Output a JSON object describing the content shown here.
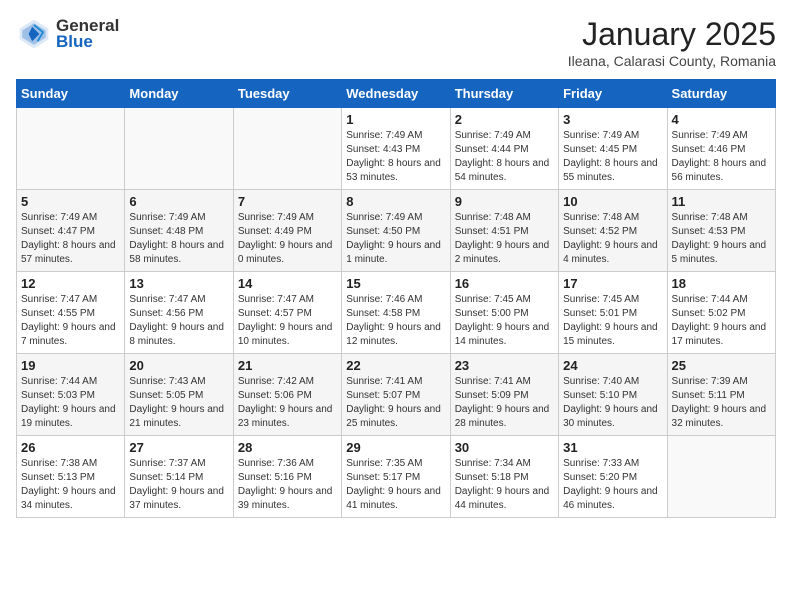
{
  "header": {
    "logo_general": "General",
    "logo_blue": "Blue",
    "title": "January 2025",
    "subtitle": "Ileana, Calarasi County, Romania"
  },
  "weekdays": [
    "Sunday",
    "Monday",
    "Tuesday",
    "Wednesday",
    "Thursday",
    "Friday",
    "Saturday"
  ],
  "weeks": [
    [
      {
        "day": "",
        "sunrise": "",
        "sunset": "",
        "daylight": ""
      },
      {
        "day": "",
        "sunrise": "",
        "sunset": "",
        "daylight": ""
      },
      {
        "day": "",
        "sunrise": "",
        "sunset": "",
        "daylight": ""
      },
      {
        "day": "1",
        "sunrise": "Sunrise: 7:49 AM",
        "sunset": "Sunset: 4:43 PM",
        "daylight": "Daylight: 8 hours and 53 minutes."
      },
      {
        "day": "2",
        "sunrise": "Sunrise: 7:49 AM",
        "sunset": "Sunset: 4:44 PM",
        "daylight": "Daylight: 8 hours and 54 minutes."
      },
      {
        "day": "3",
        "sunrise": "Sunrise: 7:49 AM",
        "sunset": "Sunset: 4:45 PM",
        "daylight": "Daylight: 8 hours and 55 minutes."
      },
      {
        "day": "4",
        "sunrise": "Sunrise: 7:49 AM",
        "sunset": "Sunset: 4:46 PM",
        "daylight": "Daylight: 8 hours and 56 minutes."
      }
    ],
    [
      {
        "day": "5",
        "sunrise": "Sunrise: 7:49 AM",
        "sunset": "Sunset: 4:47 PM",
        "daylight": "Daylight: 8 hours and 57 minutes."
      },
      {
        "day": "6",
        "sunrise": "Sunrise: 7:49 AM",
        "sunset": "Sunset: 4:48 PM",
        "daylight": "Daylight: 8 hours and 58 minutes."
      },
      {
        "day": "7",
        "sunrise": "Sunrise: 7:49 AM",
        "sunset": "Sunset: 4:49 PM",
        "daylight": "Daylight: 9 hours and 0 minutes."
      },
      {
        "day": "8",
        "sunrise": "Sunrise: 7:49 AM",
        "sunset": "Sunset: 4:50 PM",
        "daylight": "Daylight: 9 hours and 1 minute."
      },
      {
        "day": "9",
        "sunrise": "Sunrise: 7:48 AM",
        "sunset": "Sunset: 4:51 PM",
        "daylight": "Daylight: 9 hours and 2 minutes."
      },
      {
        "day": "10",
        "sunrise": "Sunrise: 7:48 AM",
        "sunset": "Sunset: 4:52 PM",
        "daylight": "Daylight: 9 hours and 4 minutes."
      },
      {
        "day": "11",
        "sunrise": "Sunrise: 7:48 AM",
        "sunset": "Sunset: 4:53 PM",
        "daylight": "Daylight: 9 hours and 5 minutes."
      }
    ],
    [
      {
        "day": "12",
        "sunrise": "Sunrise: 7:47 AM",
        "sunset": "Sunset: 4:55 PM",
        "daylight": "Daylight: 9 hours and 7 minutes."
      },
      {
        "day": "13",
        "sunrise": "Sunrise: 7:47 AM",
        "sunset": "Sunset: 4:56 PM",
        "daylight": "Daylight: 9 hours and 8 minutes."
      },
      {
        "day": "14",
        "sunrise": "Sunrise: 7:47 AM",
        "sunset": "Sunset: 4:57 PM",
        "daylight": "Daylight: 9 hours and 10 minutes."
      },
      {
        "day": "15",
        "sunrise": "Sunrise: 7:46 AM",
        "sunset": "Sunset: 4:58 PM",
        "daylight": "Daylight: 9 hours and 12 minutes."
      },
      {
        "day": "16",
        "sunrise": "Sunrise: 7:45 AM",
        "sunset": "Sunset: 5:00 PM",
        "daylight": "Daylight: 9 hours and 14 minutes."
      },
      {
        "day": "17",
        "sunrise": "Sunrise: 7:45 AM",
        "sunset": "Sunset: 5:01 PM",
        "daylight": "Daylight: 9 hours and 15 minutes."
      },
      {
        "day": "18",
        "sunrise": "Sunrise: 7:44 AM",
        "sunset": "Sunset: 5:02 PM",
        "daylight": "Daylight: 9 hours and 17 minutes."
      }
    ],
    [
      {
        "day": "19",
        "sunrise": "Sunrise: 7:44 AM",
        "sunset": "Sunset: 5:03 PM",
        "daylight": "Daylight: 9 hours and 19 minutes."
      },
      {
        "day": "20",
        "sunrise": "Sunrise: 7:43 AM",
        "sunset": "Sunset: 5:05 PM",
        "daylight": "Daylight: 9 hours and 21 minutes."
      },
      {
        "day": "21",
        "sunrise": "Sunrise: 7:42 AM",
        "sunset": "Sunset: 5:06 PM",
        "daylight": "Daylight: 9 hours and 23 minutes."
      },
      {
        "day": "22",
        "sunrise": "Sunrise: 7:41 AM",
        "sunset": "Sunset: 5:07 PM",
        "daylight": "Daylight: 9 hours and 25 minutes."
      },
      {
        "day": "23",
        "sunrise": "Sunrise: 7:41 AM",
        "sunset": "Sunset: 5:09 PM",
        "daylight": "Daylight: 9 hours and 28 minutes."
      },
      {
        "day": "24",
        "sunrise": "Sunrise: 7:40 AM",
        "sunset": "Sunset: 5:10 PM",
        "daylight": "Daylight: 9 hours and 30 minutes."
      },
      {
        "day": "25",
        "sunrise": "Sunrise: 7:39 AM",
        "sunset": "Sunset: 5:11 PM",
        "daylight": "Daylight: 9 hours and 32 minutes."
      }
    ],
    [
      {
        "day": "26",
        "sunrise": "Sunrise: 7:38 AM",
        "sunset": "Sunset: 5:13 PM",
        "daylight": "Daylight: 9 hours and 34 minutes."
      },
      {
        "day": "27",
        "sunrise": "Sunrise: 7:37 AM",
        "sunset": "Sunset: 5:14 PM",
        "daylight": "Daylight: 9 hours and 37 minutes."
      },
      {
        "day": "28",
        "sunrise": "Sunrise: 7:36 AM",
        "sunset": "Sunset: 5:16 PM",
        "daylight": "Daylight: 9 hours and 39 minutes."
      },
      {
        "day": "29",
        "sunrise": "Sunrise: 7:35 AM",
        "sunset": "Sunset: 5:17 PM",
        "daylight": "Daylight: 9 hours and 41 minutes."
      },
      {
        "day": "30",
        "sunrise": "Sunrise: 7:34 AM",
        "sunset": "Sunset: 5:18 PM",
        "daylight": "Daylight: 9 hours and 44 minutes."
      },
      {
        "day": "31",
        "sunrise": "Sunrise: 7:33 AM",
        "sunset": "Sunset: 5:20 PM",
        "daylight": "Daylight: 9 hours and 46 minutes."
      },
      {
        "day": "",
        "sunrise": "",
        "sunset": "",
        "daylight": ""
      }
    ]
  ]
}
